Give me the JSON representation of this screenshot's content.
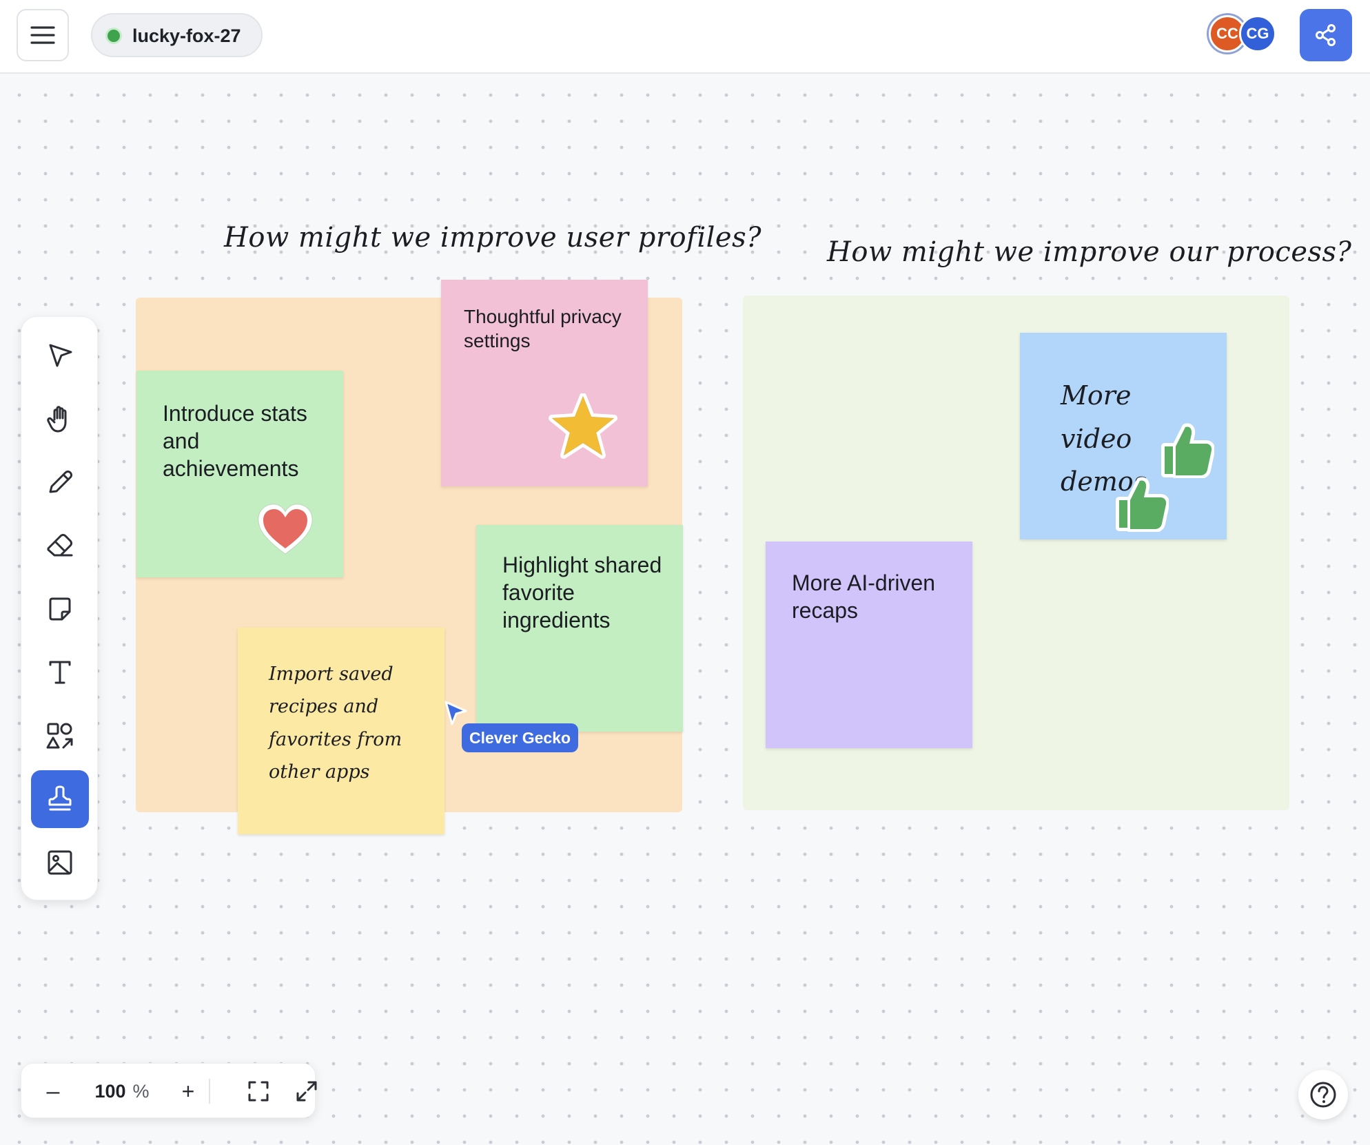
{
  "header": {
    "room_name": "lucky-fox-27",
    "room_status": "online",
    "collaborators": [
      {
        "initials": "CC",
        "color": "#dd5a24"
      },
      {
        "initials": "CG",
        "color": "#3160d8"
      }
    ],
    "menu_icon": "hamburger-menu-icon",
    "share_icon": "share-icon"
  },
  "canvas": {
    "headings": {
      "left": "How might we improve user profiles?",
      "right": "How might we improve our process?"
    },
    "stickies": {
      "stats": "Introduce stats and achievements",
      "privacy": "Thoughtful privacy settings",
      "ingredients": "Highlight shared favorite ingredients",
      "import": "Import saved recipes and favorites from other apps",
      "video": "More video demos",
      "recaps": "More AI-driven recaps"
    },
    "sticky_colors": {
      "green": "#c2eec2",
      "pink": "#f2c1d6",
      "yellow": "#fbe9a4",
      "blue": "#b1d6fa",
      "purple": "#d0c4fb"
    },
    "stickers": [
      "heart-sticker",
      "star-sticker",
      "thumbs-up-sticker",
      "thumbs-up-sticker"
    ],
    "collaborator_cursor": {
      "name": "Clever Gecko",
      "color": "#3f6be0"
    }
  },
  "toolbar": {
    "tools": [
      "select",
      "hand",
      "pencil",
      "eraser",
      "sticky-note",
      "text",
      "shapes",
      "stamp",
      "image"
    ],
    "active_tool": "stamp"
  },
  "zoom": {
    "minus": "–",
    "value": "100",
    "unit": "%",
    "plus": "+"
  }
}
